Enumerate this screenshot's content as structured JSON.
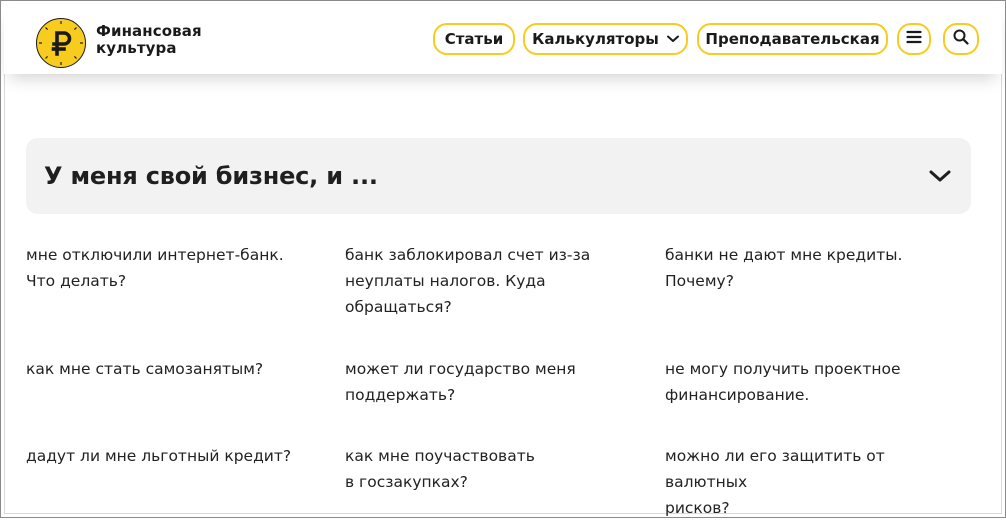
{
  "brand": {
    "line1": "Финансовая",
    "line2": "культура"
  },
  "nav": {
    "articles": "Статьи",
    "calculators": "Калькуляторы",
    "teachers": "Преподавательская"
  },
  "colors": {
    "accent": "#f7cc1f",
    "panel": "#f2f2f2",
    "text": "#222222"
  },
  "icons": [
    "ruble-logo-icon",
    "chevron-down-icon",
    "menu-icon",
    "search-icon"
  ],
  "accordion": {
    "title": "У меня свой бизнес, и ..."
  },
  "questions": [
    {
      "lines": [
        "мне отключили интернет-банк.",
        "Что делать?"
      ]
    },
    {
      "lines": [
        "банк заблокировал счет из-за",
        "неуплаты налогов. Куда",
        "обращаться?"
      ]
    },
    {
      "lines": [
        "банки не дают мне кредиты.",
        "Почему?"
      ]
    },
    {
      "lines": [
        "как мне стать самозанятым?"
      ]
    },
    {
      "lines": [
        "может ли государство меня",
        "поддержать?"
      ]
    },
    {
      "lines": [
        "не могу получить проектное",
        "финансирование."
      ]
    },
    {
      "lines": [
        "дадут ли мне льготный кредит?"
      ]
    },
    {
      "lines": [
        "как мне поучаствовать",
        "в госзакупках?"
      ]
    },
    {
      "lines": [
        "можно ли его защитить от валютных",
        "рисков?"
      ]
    }
  ]
}
